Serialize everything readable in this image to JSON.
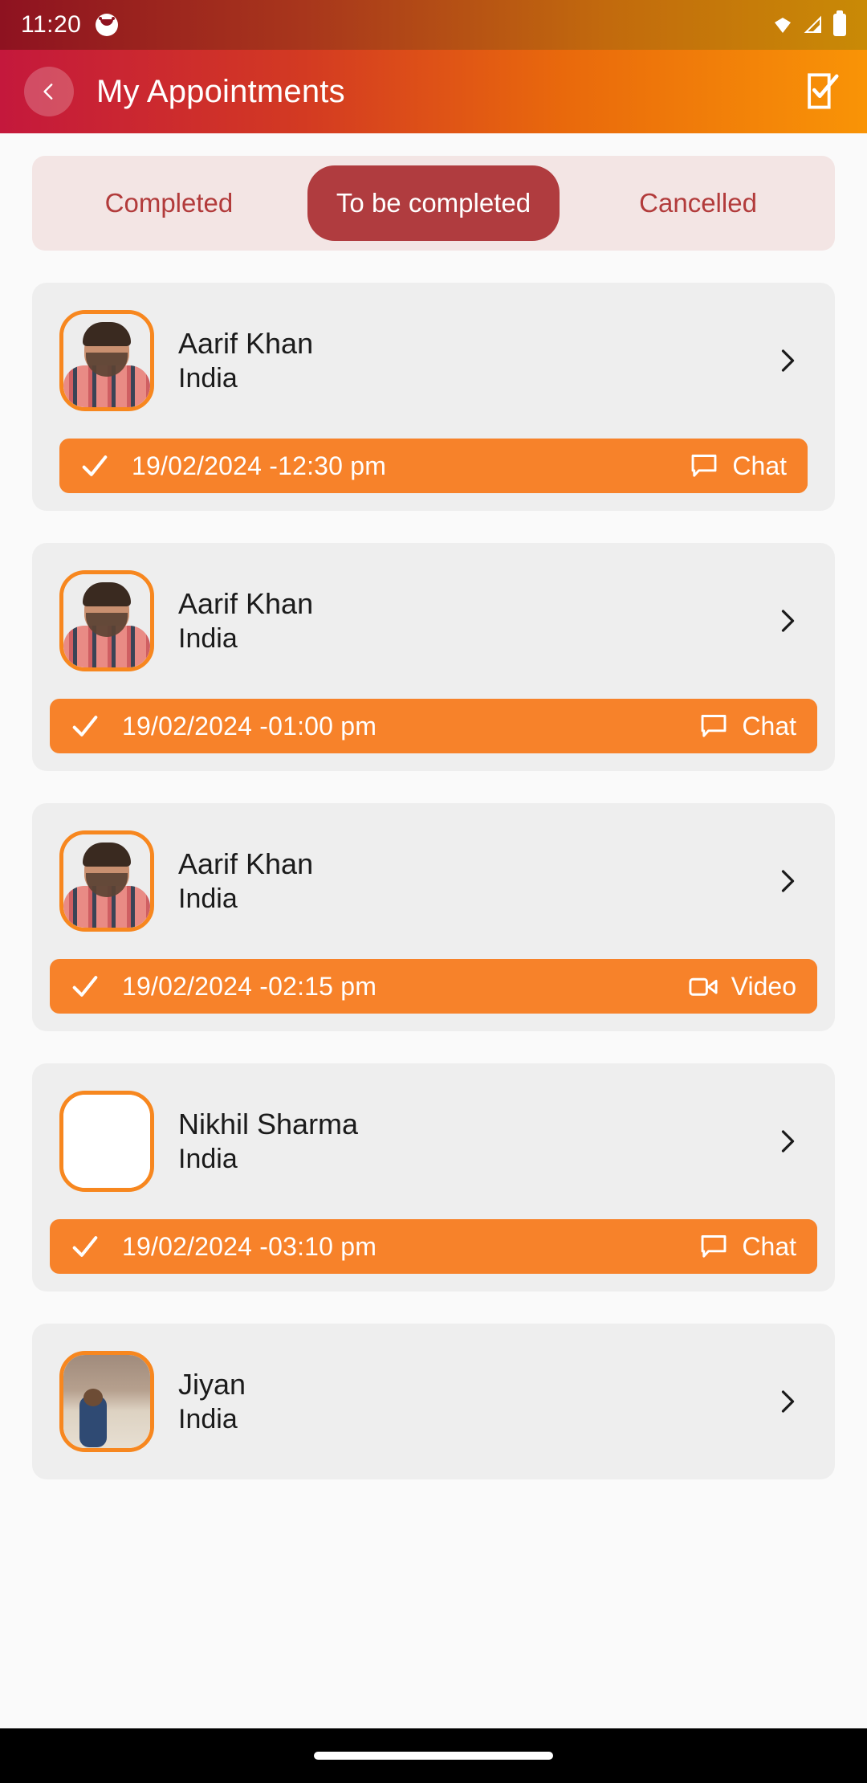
{
  "status_bar": {
    "time": "11:20",
    "icons": [
      "app-notification-icon",
      "wifi-icon",
      "signal-icon",
      "battery-icon"
    ]
  },
  "app_bar": {
    "title": "My Appointments",
    "back_icon": "chevron-left-icon",
    "action_icon": "edit-checklist-icon"
  },
  "tabs": [
    {
      "label": "Completed",
      "active": false
    },
    {
      "label": "To be completed",
      "active": true
    },
    {
      "label": "Cancelled",
      "active": false
    }
  ],
  "colors": {
    "accent_orange": "#f7822a",
    "accent_red": "#b03c3f",
    "tab_bg": "#f3e5e4",
    "card_bg": "#eeeeee",
    "page_bg": "#fafafa"
  },
  "appointments": [
    {
      "name": "Aarif Khan",
      "location": "India",
      "datetime": "19/02/2024 -12:30 pm",
      "action_label": "Chat",
      "action_icon": "chat-bubble-icon",
      "avatar": "person",
      "check_icon": "check-icon",
      "chevron_icon": "chevron-right-icon"
    },
    {
      "name": "Aarif Khan",
      "location": "India",
      "datetime": "19/02/2024 -01:00 pm",
      "action_label": "Chat",
      "action_icon": "chat-bubble-icon",
      "avatar": "person",
      "check_icon": "check-icon",
      "chevron_icon": "chevron-right-icon"
    },
    {
      "name": "Aarif Khan",
      "location": "India",
      "datetime": "19/02/2024 -02:15 pm",
      "action_label": "Video",
      "action_icon": "video-camera-icon",
      "avatar": "person",
      "check_icon": "check-icon",
      "chevron_icon": "chevron-right-icon"
    },
    {
      "name": "Nikhil Sharma",
      "location": "India",
      "datetime": "19/02/2024 -03:10 pm",
      "action_label": "Chat",
      "action_icon": "chat-bubble-icon",
      "avatar": "empty",
      "check_icon": "check-icon",
      "chevron_icon": "chevron-right-icon"
    },
    {
      "name": "Jiyan",
      "location": "India",
      "datetime": "",
      "action_label": "",
      "action_icon": "",
      "avatar": "child",
      "check_icon": "",
      "chevron_icon": "chevron-right-icon"
    }
  ],
  "nav_bar": {
    "home_indicator": "home-indicator"
  }
}
